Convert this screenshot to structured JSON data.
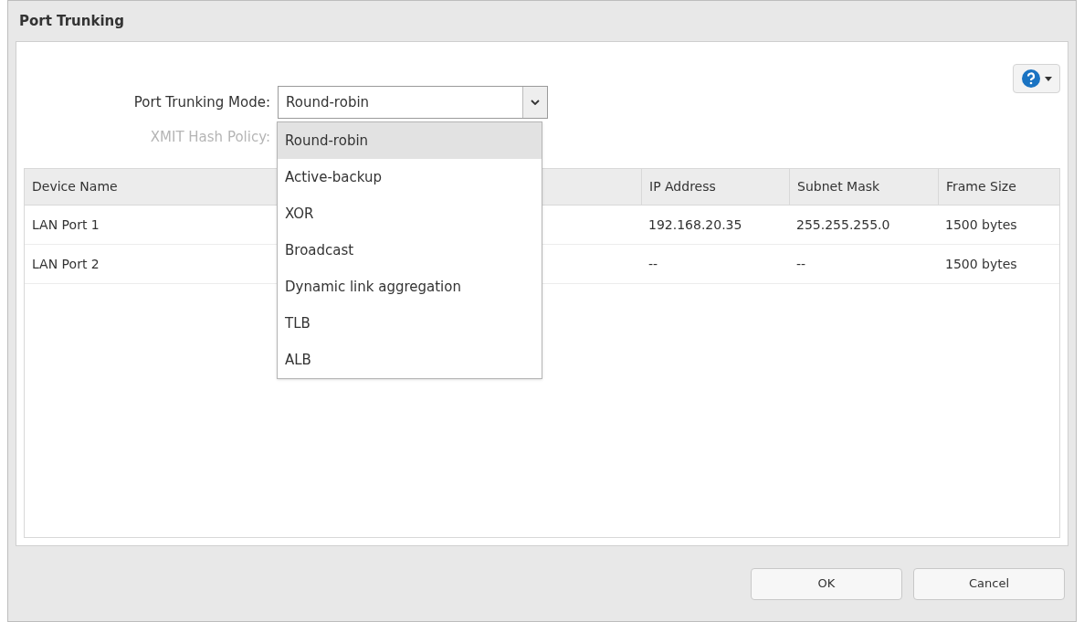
{
  "window": {
    "title": "Port Trunking"
  },
  "form": {
    "mode_label": "Port Trunking Mode:",
    "mode_value": "Round-robin",
    "hash_label": "XMIT Hash Policy:",
    "hash_disabled": true
  },
  "dropdown": {
    "expanded": true,
    "options": [
      {
        "label": "Round-robin",
        "selected": true
      },
      {
        "label": "Active-backup",
        "selected": false
      },
      {
        "label": "XOR",
        "selected": false
      },
      {
        "label": "Broadcast",
        "selected": false
      },
      {
        "label": "Dynamic link aggregation",
        "selected": false
      },
      {
        "label": "TLB",
        "selected": false
      },
      {
        "label": "ALB",
        "selected": false
      }
    ]
  },
  "table": {
    "columns": [
      "Device Name",
      "IP Address",
      "Subnet Mask",
      "Frame Size"
    ],
    "rows": [
      [
        "LAN Port 1",
        "192.168.20.35",
        "255.255.255.0",
        "1500 bytes"
      ],
      [
        "LAN Port 2",
        "--",
        "--",
        "1500 bytes"
      ]
    ]
  },
  "buttons": [
    "OK",
    "Cancel"
  ]
}
